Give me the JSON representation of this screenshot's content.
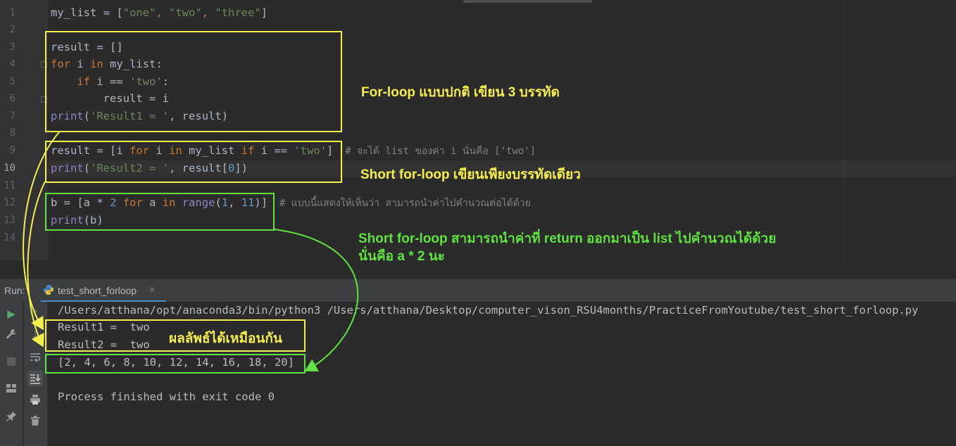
{
  "editor": {
    "line_numbers": [
      "1",
      "2",
      "3",
      "4",
      "5",
      "6",
      "7",
      "8",
      "9",
      "10",
      "11",
      "12",
      "13",
      "14"
    ],
    "current_line": "10",
    "lines": {
      "l1": {
        "var": "my_list = [",
        "s1": "\"one\"",
        "c1": ", ",
        "s2": "\"two\"",
        "c2": ", ",
        "s3": "\"three\"",
        "end": "]"
      },
      "l3": "result = []",
      "l4": {
        "kw1": "for",
        "t1": " i ",
        "kw2": "in",
        "t2": " my_list:"
      },
      "l5": {
        "indent": "    ",
        "kw": "if",
        "t1": " i == ",
        "s": "'two'",
        "t2": ":"
      },
      "l6": "        result = i",
      "l7": {
        "fn": "print",
        "t1": "(",
        "s": "'Result1 = '",
        "t2": ", result)"
      },
      "l9": {
        "t1": "result = [i ",
        "kw1": "for",
        "t2": " i ",
        "kw2": "in",
        "t3": " my_list ",
        "kw3": "if",
        "t4": " i == ",
        "s": "'two'",
        "t5": "]",
        "comment": "  # จะได้ list ของค่า i นั่นคือ ['two']"
      },
      "l10": {
        "fn": "print",
        "t1": "(",
        "s": "'Result2 = '",
        "t2": ", result[",
        "n": "0",
        "t3": "])"
      },
      "l12": {
        "t1": "b = [a * ",
        "n1": "2",
        "t2": " ",
        "kw1": "for",
        "t3": " a ",
        "kw2": "in",
        "t4": " ",
        "fn": "range",
        "t5": "(",
        "n2": "1",
        "t6": ", ",
        "n3": "11",
        "t7": ")]",
        "comment": "  # แบบนี้แสดงให้เห็นว่า สามารถนำค่าไปคำนวณต่อได้ด้วย"
      },
      "l13": {
        "fn": "print",
        "t1": "(b)"
      }
    }
  },
  "annotations": {
    "note1": "For-loop แบบปกติ เขียน 3 บรรทัด",
    "note2": "Short for-loop เขียนเพียงบรรทัดเดียว",
    "note3_line1": "Short for-loop สามารถนำค่าที่ return ออกมาเป็น list ไปคำนวณได้ด้วย",
    "note3_line2": "นั่นคือ a * 2 นะ",
    "note4": "ผลลัพธ์ได้เหมือนกัน",
    "colors": {
      "yellow": "#f5ef4e",
      "green": "#5fe13f"
    }
  },
  "run_panel": {
    "label": "Run:",
    "tab_label": "test_short_forloop",
    "tab_close": "×",
    "tab_icon": "python-icon",
    "console": {
      "command": "/Users/atthana/opt/anaconda3/bin/python3 /Users/atthana/Desktop/computer_vison_RSU4months/PracticeFromYoutube/test_short_forloop.py",
      "result1": "Result1 =  two",
      "result2": "Result2 =  two",
      "list_output": "[2, 4, 6, 8, 10, 12, 14, 16, 18, 20]",
      "exit_message": "Process finished with exit code 0"
    },
    "toolbar_icons": [
      "run-icon",
      "up-arrow-icon",
      "wrench-icon",
      "down-arrow-icon",
      "stop-icon",
      "soft-wrap-icon",
      "layout-icon",
      "scroll-to-end-icon",
      "print-icon",
      "pin-icon",
      "trash-icon"
    ]
  }
}
